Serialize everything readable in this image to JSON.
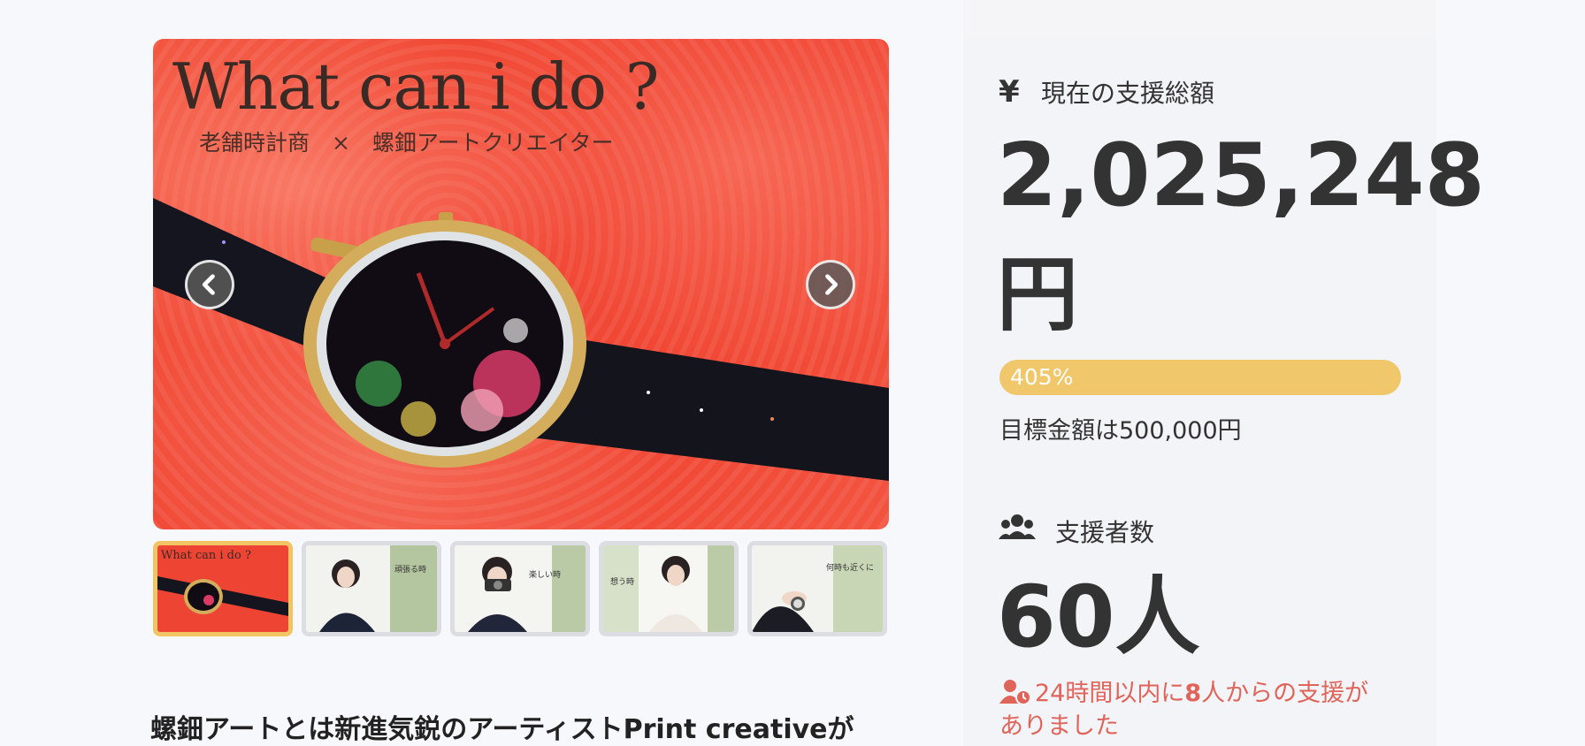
{
  "gallery": {
    "hero_title": "What can i do ?",
    "hero_subtitle": "老舗時計商　×　螺鈿アートクリエイター",
    "prev_icon": "chevron-left-icon",
    "next_icon": "chevron-right-icon",
    "thumbnails": [
      {
        "caption": "What can i do ?",
        "active": true
      },
      {
        "caption": "頑張る時",
        "active": false
      },
      {
        "caption": "楽しい時",
        "active": false
      },
      {
        "caption": "想う時",
        "active": false
      },
      {
        "caption": "何時も近くに",
        "active": false
      }
    ]
  },
  "description_heading": "螺鈿アートとは新進気鋭のアーティストPrint creativeが",
  "stats": {
    "total_label": "現在の支援総額",
    "total_icon": "yen-icon",
    "total_amount": "2,025,248",
    "total_unit": "円",
    "progress_percent": 405,
    "progress_label": "405%",
    "goal_text": "目標金額は500,000円",
    "backers_label": "支援者数",
    "backers_icon": "users-icon",
    "backers_count": "60人",
    "recent_icon": "user-clock-icon",
    "recent_prefix": "24時間以内に",
    "recent_count": "8",
    "recent_suffix": "人からの支援がありました"
  },
  "colors": {
    "accent": "#f1c76b",
    "alert": "#e0645a",
    "text": "#333333",
    "background": "#f7f8fb"
  }
}
